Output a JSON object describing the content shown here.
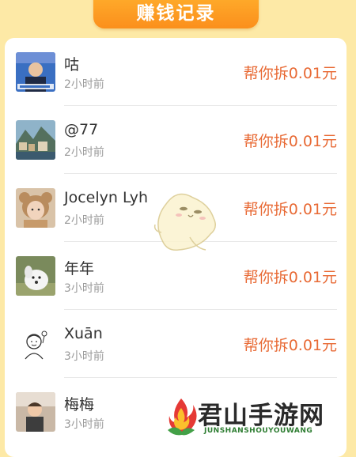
{
  "header": {
    "title": "赚钱记录"
  },
  "records": [
    {
      "name": "咕",
      "time": "2小时前",
      "action": "帮你拆0.01元",
      "avatar": "man-presenter-photo"
    },
    {
      "name": "@77",
      "time": "2小时前",
      "action": "帮你拆0.01元",
      "avatar": "lakeside-town-photo"
    },
    {
      "name": "Jocelyn Lyh",
      "time": "2小时前",
      "action": "帮你拆0.01元",
      "avatar": "girl-bear-hat-photo"
    },
    {
      "name": "年年",
      "time": "3小时前",
      "action": "帮你拆0.01元",
      "avatar": "white-puppy-photo"
    },
    {
      "name": "Xuān",
      "time": "3小时前",
      "action": "帮你拆0.01元",
      "avatar": "line-doodle-avatar"
    },
    {
      "name": "梅梅",
      "time": "3小时前",
      "action": "",
      "avatar": "child-photo"
    }
  ],
  "watermark": {
    "title": "君山手游网",
    "subtitle": "JUNSHANSHOUYOUWANG"
  },
  "colors": {
    "page_background": "#fde9a6",
    "header_orange": "#fb8f1c",
    "action_text": "#e86a35",
    "name_text": "#333333",
    "time_text": "#9b9b9b"
  }
}
